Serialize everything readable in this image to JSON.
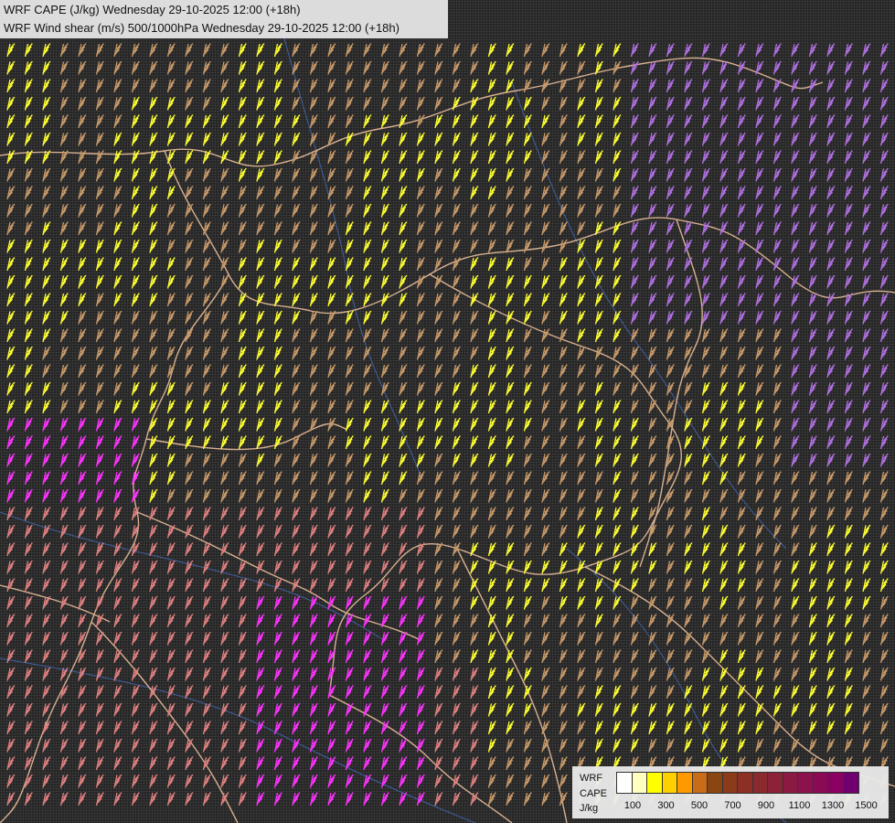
{
  "header": {
    "line1": "WRF CAPE (J/kg) Wednesday 29-10-2025 12:00 (+18h)",
    "line2": "WRF Wind shear (m/s) 500/1000hPa Wednesday 29-10-2025 12:00 (+18h)"
  },
  "legend": {
    "title_line1": "WRF",
    "title_line2": "CAPE",
    "unit": "J/kg",
    "colors": [
      "#ffffff",
      "#ffffc0",
      "#ffff00",
      "#ffd000",
      "#ff9900",
      "#c86c18",
      "#8b4513",
      "#8b3a1a",
      "#8c2f24",
      "#8b2a2e",
      "#8b2238",
      "#8b1a42",
      "#8b124c",
      "#8b0a56",
      "#8b0060",
      "#700070"
    ],
    "ticks": [
      "100",
      "300",
      "500",
      "700",
      "900",
      "1100",
      "1300",
      "1500"
    ]
  },
  "map": {
    "palette": {
      "yellow": "#ffff33",
      "tan": "#c89a6a",
      "salmon": "#e08080",
      "magenta": "#ff33ff",
      "violet": "#b070e0",
      "border": "#d8b090",
      "river": "#4060a0"
    }
  }
}
